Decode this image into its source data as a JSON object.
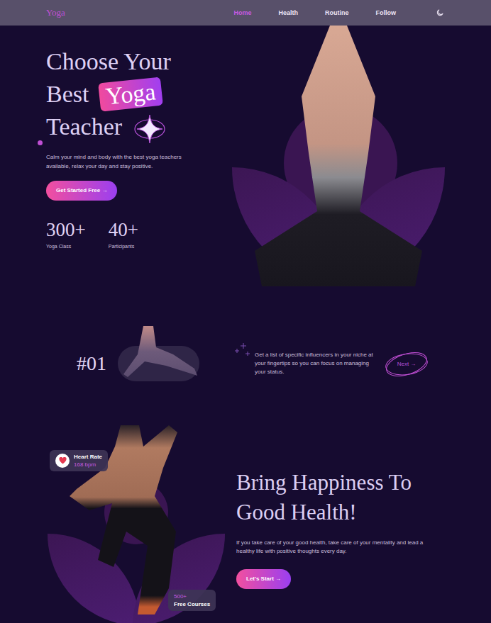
{
  "header": {
    "logo": "Yoga",
    "nav": [
      {
        "label": "Home",
        "selected": true
      },
      {
        "label": "Health",
        "selected": false
      },
      {
        "label": "Routine",
        "selected": false
      },
      {
        "label": "Follow",
        "selected": false
      }
    ]
  },
  "hero": {
    "title": {
      "line1": "Choose Your",
      "line2": "Best",
      "highlight": "Yoga",
      "line3": "Teacher"
    },
    "description": "Calm your mind and body with the best yoga teachers available, relax your day and stay positive.",
    "button": "Get Started Free →",
    "stats": [
      {
        "value": "300+",
        "label": "Yoga Class"
      },
      {
        "value": "40+",
        "label": "Participants"
      }
    ]
  },
  "feature": {
    "number": "#01",
    "text": "Get a list of specific influencers in your niche at your fingertips so you can focus on managing your status.",
    "button": "Next →"
  },
  "health": {
    "heart_badge": {
      "title": "Heart Rate",
      "value": "168 bpm"
    },
    "courses_badge": {
      "value": "500+",
      "label": "Free Courses"
    },
    "title_lines": [
      "Bring Happiness To",
      "Good Health!"
    ],
    "description": "If you take care of your good health, take care of your mentality and lead a healthy life with positive thoughts every day.",
    "button": "Let's Start →"
  }
}
